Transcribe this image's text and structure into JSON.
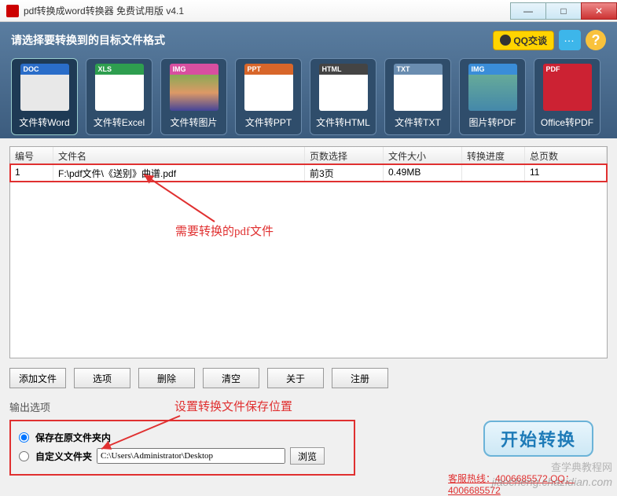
{
  "window": {
    "title": "pdf转换成word转换器 免费试用版 v4.1"
  },
  "toolbar": {
    "prompt": "请选择要转换到的目标文件格式",
    "qq_label": "QQ交谈",
    "help_glyph": "?",
    "formats": [
      {
        "cap": "DOC",
        "label": "文件转Word",
        "capbg": "#2a6dc9",
        "body": "#e8e8e8"
      },
      {
        "cap": "XLS",
        "label": "文件转Excel",
        "capbg": "#2e9e4f",
        "body": "#fff"
      },
      {
        "cap": "IMG",
        "label": "文件转图片",
        "capbg": "#d84fa0",
        "body": "linear-gradient(#8a5,#d96,#449)"
      },
      {
        "cap": "PPT",
        "label": "文件转PPT",
        "capbg": "#d8662a",
        "body": "#fff"
      },
      {
        "cap": "HTML",
        "label": "文件转HTML",
        "capbg": "#444",
        "body": "#fff"
      },
      {
        "cap": "TXT",
        "label": "文件转TXT",
        "capbg": "#6a8db0",
        "body": "#fff"
      },
      {
        "cap": "IMG",
        "label": "图片转PDF",
        "capbg": "#3a8dd8",
        "body": "linear-gradient(#6a9,#48a)"
      },
      {
        "cap": "PDF",
        "label": "Office转PDF",
        "capbg": "#c23",
        "body": "#c23"
      }
    ]
  },
  "table": {
    "headers": {
      "id": "编号",
      "name": "文件名",
      "pages": "页数选择",
      "size": "文件大小",
      "prog": "转换进度",
      "total": "总页数"
    },
    "rows": [
      {
        "id": "1",
        "name": "F:\\pdf文件\\《送别》曲谱.pdf",
        "pages": "前3页",
        "size": "0.49MB",
        "prog": "",
        "total": "11"
      }
    ]
  },
  "annotations": {
    "file_note": "需要转换的pdf文件",
    "save_note": "设置转换文件保存位置"
  },
  "buttons": {
    "add": "添加文件",
    "options": "选项",
    "delete": "删除",
    "clear": "清空",
    "about": "关于",
    "register": "注册",
    "start": "开始转换",
    "browse": "浏览"
  },
  "output": {
    "section_label": "输出选项",
    "save_original": "保存在原文件夹内",
    "custom_folder": "自定义文件夹",
    "path": "C:\\Users\\Administrator\\Desktop"
  },
  "footer": {
    "hotline": "客服热线：4006685572 QQ：4006685572",
    "watermark_top": "查学典教程网",
    "watermark_bottom": "jiaocheng.chazidian.com"
  }
}
